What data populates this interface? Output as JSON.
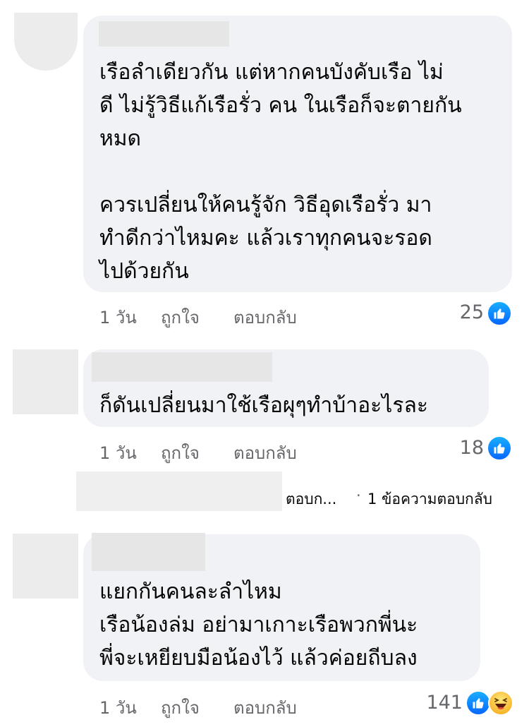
{
  "comments": [
    {
      "text": "เรือลำเดียวกัน แต่หากคนบังคับเรือ ไม่\nดี ไม่รู้วิธีแก้เรือรั่ว คน ในเรือก็จะตายกัน\nหมด\n\nควรเปลี่ยนให้คนรู้จัก วิธีอุดเรือรั่ว มา\nทำดีกว่าไหมคะ แล้วเราทุกคนจะรอด\nไปด้วยกัน",
      "time": "1 วัน",
      "like_label": "ถูกใจ",
      "reply_label": "ตอบกลับ",
      "reaction_count": "25",
      "reactions": [
        "like-icon"
      ]
    },
    {
      "text": "ก็ดันเปลี่ยนมาใช้เรือผุๆทำบ้าอะไรละ",
      "time": "1 วัน",
      "like_label": "ถูกใจ",
      "reply_label": "ตอบกลับ",
      "reaction_count": "18",
      "reactions": [
        "like-icon"
      ]
    },
    {
      "text": "แยกกันคนละลำไหม\nเรือน้องล่ม อย่ามาเกาะเรือพวกพี่นะ\nพี่จะเหยียบมือน้องไว้ แล้วค่อยถีบลง",
      "time": "1 วัน",
      "like_label": "ถูกใจ",
      "reply_label": "ตอบกลับ",
      "reaction_count": "141",
      "reactions": [
        "like-icon",
        "haha-icon"
      ]
    }
  ],
  "reply_thread": {
    "reply_text": "ตอบก...",
    "separator": "·",
    "count_text": "1 ข้อความตอบกลับ"
  },
  "colors": {
    "bubble_bg": "#f0f2f5",
    "meta_text": "#65676b",
    "like_blue": "#0866ff"
  }
}
